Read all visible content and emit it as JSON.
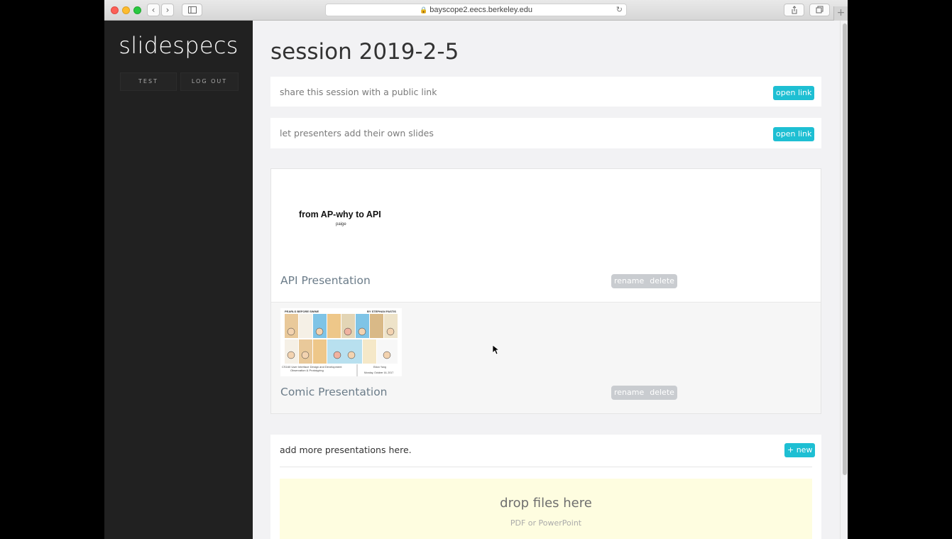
{
  "browser": {
    "url": "bayscope2.eecs.berkeley.edu",
    "back": "‹",
    "forward": "›",
    "plus": "+"
  },
  "sidebar": {
    "brand": "slidespecs",
    "nav": [
      {
        "label": "TEST"
      },
      {
        "label": "LOG OUT"
      }
    ]
  },
  "main": {
    "title": "session 2019-2-5",
    "share_cards": [
      {
        "text": "share this session with a public link",
        "button": "open link"
      },
      {
        "text": "let presenters add their own slides",
        "button": "open link"
      }
    ],
    "presentations": [
      {
        "name": "API Presentation",
        "thumb_title": "from AP-why to API",
        "thumb_subtitle": "paige",
        "rename": "rename",
        "delete": "delete"
      },
      {
        "name": "Comic Presentation",
        "thumb_header_left": "PEARLS BEFORE SWINE",
        "thumb_header_right": "BY STEPHAN PASTIS",
        "thumb_caption_1": "CS160 User Interface Design and Development",
        "thumb_caption_2": "Observation & Prototyping",
        "thumb_author": "Eldon Yang",
        "thumb_date": "Monday, October 16, 2017",
        "rename": "rename",
        "delete": "delete"
      }
    ],
    "add_more": {
      "text": "add more presentations here.",
      "button": "+ new",
      "drop_title": "drop files here",
      "drop_subtitle": "PDF or PowerPoint"
    }
  },
  "colors": {
    "accent": "#1ebfd3",
    "sidebar_bg": "#212121",
    "page_bg": "#f2f2f4",
    "drop_bg": "#fefde0",
    "pill_bg": "#c9ccd0"
  }
}
